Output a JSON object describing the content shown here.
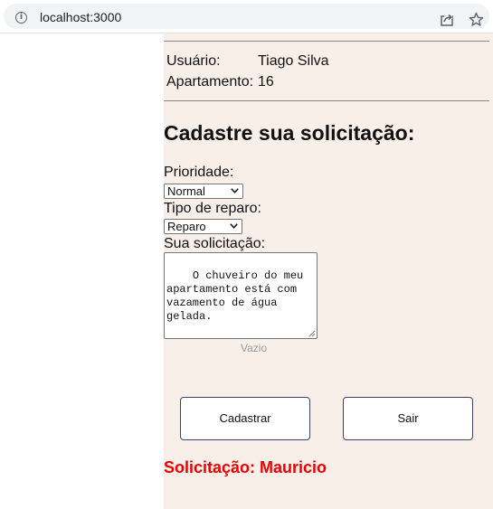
{
  "browser": {
    "url": "localhost:3000",
    "icons": [
      "info-icon",
      "share-icon",
      "star-icon"
    ]
  },
  "user": {
    "user_label": "Usuário:",
    "user_name": "Tiago Silva",
    "apartment_label": "Apartamento:",
    "apartment_number": "16"
  },
  "form": {
    "title": "Cadastre sua solicitação:",
    "priority_label": "Prioridade:",
    "priority_value": "Normal",
    "repair_type_label": "Tipo de reparo:",
    "repair_type_value": "Reparo",
    "request_label": "Sua solicitação:",
    "request_text": "O chuveiro do meu apartamento está com vazamento de água gelada.",
    "counter_text": "Vazio",
    "submit_label": "Cadastrar",
    "exit_label": "Sair"
  },
  "status": {
    "text": "Solicitação: Mauricio",
    "color": "#ee0000"
  },
  "colors": {
    "panel_background": "#f8efe9",
    "button_border": "#3d3f6e"
  }
}
